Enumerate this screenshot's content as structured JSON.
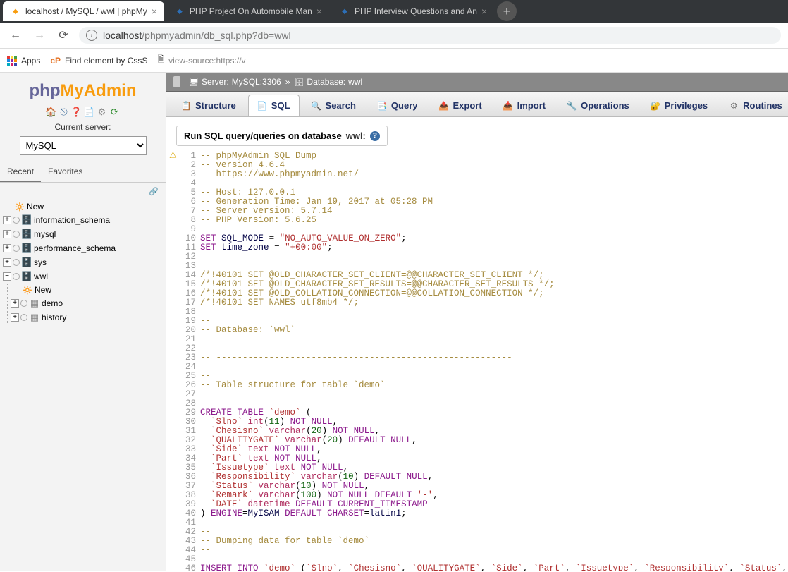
{
  "browser": {
    "tabs": [
      {
        "title": "localhost / MySQL / wwl | phpMy",
        "active": true,
        "favcolor": "#f89c0e"
      },
      {
        "title": "PHP Project On Automobile Man",
        "active": false,
        "favcolor": "#2d6fb7"
      },
      {
        "title": "PHP Interview Questions and An",
        "active": false,
        "favcolor": "#2d6fb7"
      }
    ],
    "url_host": "localhost",
    "url_path": "/phpmyadmin/db_sql.php?db=wwl",
    "bookmarks": {
      "apps": "Apps",
      "find_elem": "Find element by CssS",
      "view_source": "view-source:https://v"
    }
  },
  "sidebar": {
    "server_label": "Current server:",
    "server_value": "MySQL",
    "subtabs": {
      "recent": "Recent",
      "favorites": "Favorites"
    },
    "tree": {
      "new": "New",
      "dbs": [
        "information_schema",
        "mysql",
        "performance_schema",
        "sys"
      ],
      "open_db": "wwl",
      "open_children": {
        "new": "New",
        "tables": [
          "demo",
          "history"
        ]
      }
    }
  },
  "breadcrumb": {
    "server_prefix": "Server:",
    "server": "MySQL:3306",
    "db_prefix": "Database:",
    "db": "wwl"
  },
  "maintabs": [
    {
      "label": "Structure",
      "icon": "📋",
      "color": "#a07030"
    },
    {
      "label": "SQL",
      "icon": "📄",
      "color": "#5a7a3a",
      "active": true
    },
    {
      "label": "Search",
      "icon": "🔍",
      "color": "#3a6a9a"
    },
    {
      "label": "Query",
      "icon": "📑",
      "color": "#777"
    },
    {
      "label": "Export",
      "icon": "📤",
      "color": "#3a8a3a"
    },
    {
      "label": "Import",
      "icon": "📥",
      "color": "#8a3a3a"
    },
    {
      "label": "Operations",
      "icon": "🔧",
      "color": "#557"
    },
    {
      "label": "Privileges",
      "icon": "🔐",
      "color": "#557"
    },
    {
      "label": "Routines",
      "icon": "⚙",
      "color": "#777"
    }
  ],
  "query_title": {
    "prefix": "Run SQL query/queries on database ",
    "dbname": "wwl:"
  },
  "sql": {
    "lines": [
      {
        "n": 1,
        "t": "cm",
        "s": "-- phpMyAdmin SQL Dump"
      },
      {
        "n": 2,
        "t": "cm",
        "s": "-- version 4.6.4"
      },
      {
        "n": 3,
        "t": "cm",
        "s": "-- https://www.phpmyadmin.net/"
      },
      {
        "n": 4,
        "t": "cm",
        "s": "--"
      },
      {
        "n": 5,
        "t": "cm",
        "s": "-- Host: 127.0.0.1"
      },
      {
        "n": 6,
        "t": "cm",
        "s": "-- Generation Time: Jan 19, 2017 at 05:28 PM"
      },
      {
        "n": 7,
        "t": "cm",
        "s": "-- Server version: 5.7.14"
      },
      {
        "n": 8,
        "t": "cm",
        "s": "-- PHP Version: 5.6.25"
      },
      {
        "n": 9,
        "t": "",
        "s": ""
      },
      {
        "n": 10,
        "t": "set",
        "s": "SET SQL_MODE = \"NO_AUTO_VALUE_ON_ZERO\";"
      },
      {
        "n": 11,
        "t": "set",
        "s": "SET time_zone = \"+00:00\";"
      },
      {
        "n": 12,
        "t": "",
        "s": ""
      },
      {
        "n": 13,
        "t": "",
        "s": ""
      },
      {
        "n": 14,
        "t": "cd",
        "s": "/*!40101 SET @OLD_CHARACTER_SET_CLIENT=@@CHARACTER_SET_CLIENT */;"
      },
      {
        "n": 15,
        "t": "cd",
        "s": "/*!40101 SET @OLD_CHARACTER_SET_RESULTS=@@CHARACTER_SET_RESULTS */;"
      },
      {
        "n": 16,
        "t": "cd",
        "s": "/*!40101 SET @OLD_COLLATION_CONNECTION=@@COLLATION_CONNECTION */;"
      },
      {
        "n": 17,
        "t": "cd",
        "s": "/*!40101 SET NAMES utf8mb4 */;"
      },
      {
        "n": 18,
        "t": "",
        "s": ""
      },
      {
        "n": 19,
        "t": "cm",
        "s": "--"
      },
      {
        "n": 20,
        "t": "cm",
        "s": "-- Database: `wwl`"
      },
      {
        "n": 21,
        "t": "cm",
        "s": "--"
      },
      {
        "n": 22,
        "t": "",
        "s": ""
      },
      {
        "n": 23,
        "t": "cm",
        "s": "-- --------------------------------------------------------"
      },
      {
        "n": 24,
        "t": "",
        "s": ""
      },
      {
        "n": 25,
        "t": "cm",
        "s": "--"
      },
      {
        "n": 26,
        "t": "cm",
        "s": "-- Table structure for table `demo`"
      },
      {
        "n": 27,
        "t": "cm",
        "s": "--"
      },
      {
        "n": 28,
        "t": "",
        "s": ""
      },
      {
        "n": 29,
        "t": "ct",
        "s": "CREATE TABLE `demo` ("
      },
      {
        "n": 30,
        "t": "col",
        "s": "  `Slno` int(11) NOT NULL,"
      },
      {
        "n": 31,
        "t": "col",
        "s": "  `Chesisno` varchar(20) NOT NULL,"
      },
      {
        "n": 32,
        "t": "col",
        "s": "  `QUALITYGATE` varchar(20) DEFAULT NULL,"
      },
      {
        "n": 33,
        "t": "col",
        "s": "  `Side` text NOT NULL,"
      },
      {
        "n": 34,
        "t": "col",
        "s": "  `Part` text NOT NULL,"
      },
      {
        "n": 35,
        "t": "col",
        "s": "  `Issuetype` text NOT NULL,"
      },
      {
        "n": 36,
        "t": "col",
        "s": "  `Responsibility` varchar(10) DEFAULT NULL,"
      },
      {
        "n": 37,
        "t": "col",
        "s": "  `Status` varchar(10) NOT NULL,"
      },
      {
        "n": 38,
        "t": "col",
        "s": "  `Remark` varchar(100) NOT NULL DEFAULT '-',"
      },
      {
        "n": 39,
        "t": "col",
        "s": "  `DATE` datetime DEFAULT CURRENT_TIMESTAMP"
      },
      {
        "n": 40,
        "t": "eng",
        "s": ") ENGINE=MyISAM DEFAULT CHARSET=latin1;"
      },
      {
        "n": 41,
        "t": "",
        "s": ""
      },
      {
        "n": 42,
        "t": "cm",
        "s": "--"
      },
      {
        "n": 43,
        "t": "cm",
        "s": "-- Dumping data for table `demo`"
      },
      {
        "n": 44,
        "t": "cm",
        "s": "--"
      },
      {
        "n": 45,
        "t": "",
        "s": ""
      },
      {
        "n": 46,
        "t": "ins",
        "s": "INSERT INTO `demo` (`Slno`, `Chesisno`, `QUALITYGATE`, `Side`, `Part`, `Issuetype`, `Responsibility`, `Status`, `Remark`, `DATE`) VALUES"
      }
    ]
  }
}
